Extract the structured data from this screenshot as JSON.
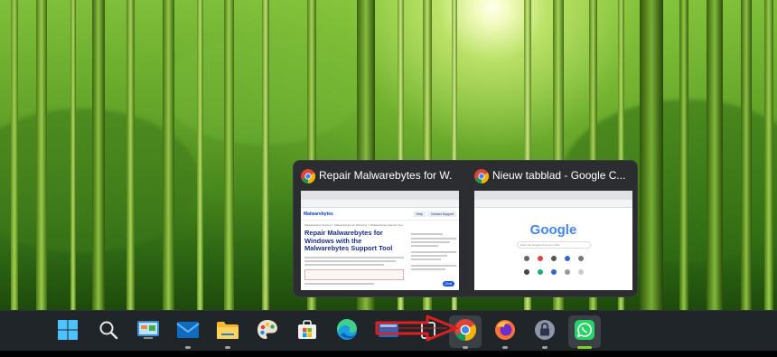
{
  "taskbar": {
    "apps": [
      {
        "name": "start"
      },
      {
        "name": "search"
      },
      {
        "name": "control-panel"
      },
      {
        "name": "mail"
      },
      {
        "name": "file-explorer"
      },
      {
        "name": "paint"
      },
      {
        "name": "microsoft-store"
      },
      {
        "name": "edge"
      },
      {
        "name": "task-view"
      },
      {
        "name": "chrome"
      },
      {
        "name": "firefox"
      },
      {
        "name": "vpn"
      },
      {
        "name": "whatsapp"
      }
    ]
  },
  "thumbnails": [
    {
      "title": "Repair Malwarebytes for W...",
      "preview": {
        "brand": "Malwarebytes",
        "nav": [
          "Help",
          "Contact Support"
        ],
        "breadcrumb": "Malwarebytes Support > Malwarebytes for Windows > Malwarebytes Support Tool",
        "heading": "Repair Malwarebytes for Windows with the Malwarebytes Support Tool",
        "badge": "Chat"
      }
    },
    {
      "title": "Nieuw tabblad - Google C...",
      "preview": {
        "logo": "Google",
        "search_placeholder": "Zoek met Google of typ een URL"
      }
    }
  ],
  "colors": {
    "accent_red": "#e01e1e",
    "taskbar": "#20252a",
    "popup": "#2b2d31",
    "whatsapp_indicator": "#7ed321"
  }
}
